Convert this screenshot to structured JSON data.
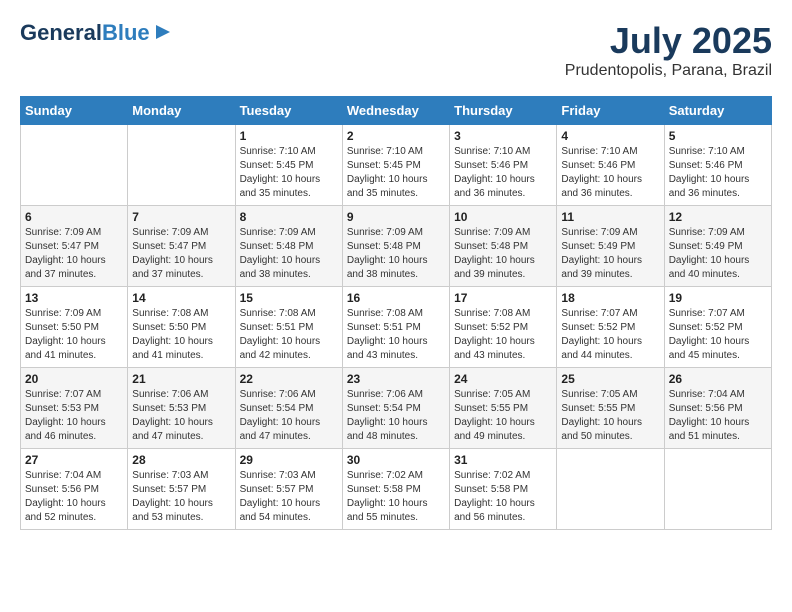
{
  "logo": {
    "general": "General",
    "blue": "Blue",
    "arrow": "▶"
  },
  "header": {
    "month": "July 2025",
    "location": "Prudentopolis, Parana, Brazil"
  },
  "days_of_week": [
    "Sunday",
    "Monday",
    "Tuesday",
    "Wednesday",
    "Thursday",
    "Friday",
    "Saturday"
  ],
  "weeks": [
    [
      {
        "day": "",
        "detail": ""
      },
      {
        "day": "",
        "detail": ""
      },
      {
        "day": "1",
        "detail": "Sunrise: 7:10 AM\nSunset: 5:45 PM\nDaylight: 10 hours\nand 35 minutes."
      },
      {
        "day": "2",
        "detail": "Sunrise: 7:10 AM\nSunset: 5:45 PM\nDaylight: 10 hours\nand 35 minutes."
      },
      {
        "day": "3",
        "detail": "Sunrise: 7:10 AM\nSunset: 5:46 PM\nDaylight: 10 hours\nand 36 minutes."
      },
      {
        "day": "4",
        "detail": "Sunrise: 7:10 AM\nSunset: 5:46 PM\nDaylight: 10 hours\nand 36 minutes."
      },
      {
        "day": "5",
        "detail": "Sunrise: 7:10 AM\nSunset: 5:46 PM\nDaylight: 10 hours\nand 36 minutes."
      }
    ],
    [
      {
        "day": "6",
        "detail": "Sunrise: 7:09 AM\nSunset: 5:47 PM\nDaylight: 10 hours\nand 37 minutes."
      },
      {
        "day": "7",
        "detail": "Sunrise: 7:09 AM\nSunset: 5:47 PM\nDaylight: 10 hours\nand 37 minutes."
      },
      {
        "day": "8",
        "detail": "Sunrise: 7:09 AM\nSunset: 5:48 PM\nDaylight: 10 hours\nand 38 minutes."
      },
      {
        "day": "9",
        "detail": "Sunrise: 7:09 AM\nSunset: 5:48 PM\nDaylight: 10 hours\nand 38 minutes."
      },
      {
        "day": "10",
        "detail": "Sunrise: 7:09 AM\nSunset: 5:48 PM\nDaylight: 10 hours\nand 39 minutes."
      },
      {
        "day": "11",
        "detail": "Sunrise: 7:09 AM\nSunset: 5:49 PM\nDaylight: 10 hours\nand 39 minutes."
      },
      {
        "day": "12",
        "detail": "Sunrise: 7:09 AM\nSunset: 5:49 PM\nDaylight: 10 hours\nand 40 minutes."
      }
    ],
    [
      {
        "day": "13",
        "detail": "Sunrise: 7:09 AM\nSunset: 5:50 PM\nDaylight: 10 hours\nand 41 minutes."
      },
      {
        "day": "14",
        "detail": "Sunrise: 7:08 AM\nSunset: 5:50 PM\nDaylight: 10 hours\nand 41 minutes."
      },
      {
        "day": "15",
        "detail": "Sunrise: 7:08 AM\nSunset: 5:51 PM\nDaylight: 10 hours\nand 42 minutes."
      },
      {
        "day": "16",
        "detail": "Sunrise: 7:08 AM\nSunset: 5:51 PM\nDaylight: 10 hours\nand 43 minutes."
      },
      {
        "day": "17",
        "detail": "Sunrise: 7:08 AM\nSunset: 5:52 PM\nDaylight: 10 hours\nand 43 minutes."
      },
      {
        "day": "18",
        "detail": "Sunrise: 7:07 AM\nSunset: 5:52 PM\nDaylight: 10 hours\nand 44 minutes."
      },
      {
        "day": "19",
        "detail": "Sunrise: 7:07 AM\nSunset: 5:52 PM\nDaylight: 10 hours\nand 45 minutes."
      }
    ],
    [
      {
        "day": "20",
        "detail": "Sunrise: 7:07 AM\nSunset: 5:53 PM\nDaylight: 10 hours\nand 46 minutes."
      },
      {
        "day": "21",
        "detail": "Sunrise: 7:06 AM\nSunset: 5:53 PM\nDaylight: 10 hours\nand 47 minutes."
      },
      {
        "day": "22",
        "detail": "Sunrise: 7:06 AM\nSunset: 5:54 PM\nDaylight: 10 hours\nand 47 minutes."
      },
      {
        "day": "23",
        "detail": "Sunrise: 7:06 AM\nSunset: 5:54 PM\nDaylight: 10 hours\nand 48 minutes."
      },
      {
        "day": "24",
        "detail": "Sunrise: 7:05 AM\nSunset: 5:55 PM\nDaylight: 10 hours\nand 49 minutes."
      },
      {
        "day": "25",
        "detail": "Sunrise: 7:05 AM\nSunset: 5:55 PM\nDaylight: 10 hours\nand 50 minutes."
      },
      {
        "day": "26",
        "detail": "Sunrise: 7:04 AM\nSunset: 5:56 PM\nDaylight: 10 hours\nand 51 minutes."
      }
    ],
    [
      {
        "day": "27",
        "detail": "Sunrise: 7:04 AM\nSunset: 5:56 PM\nDaylight: 10 hours\nand 52 minutes."
      },
      {
        "day": "28",
        "detail": "Sunrise: 7:03 AM\nSunset: 5:57 PM\nDaylight: 10 hours\nand 53 minutes."
      },
      {
        "day": "29",
        "detail": "Sunrise: 7:03 AM\nSunset: 5:57 PM\nDaylight: 10 hours\nand 54 minutes."
      },
      {
        "day": "30",
        "detail": "Sunrise: 7:02 AM\nSunset: 5:58 PM\nDaylight: 10 hours\nand 55 minutes."
      },
      {
        "day": "31",
        "detail": "Sunrise: 7:02 AM\nSunset: 5:58 PM\nDaylight: 10 hours\nand 56 minutes."
      },
      {
        "day": "",
        "detail": ""
      },
      {
        "day": "",
        "detail": ""
      }
    ]
  ]
}
